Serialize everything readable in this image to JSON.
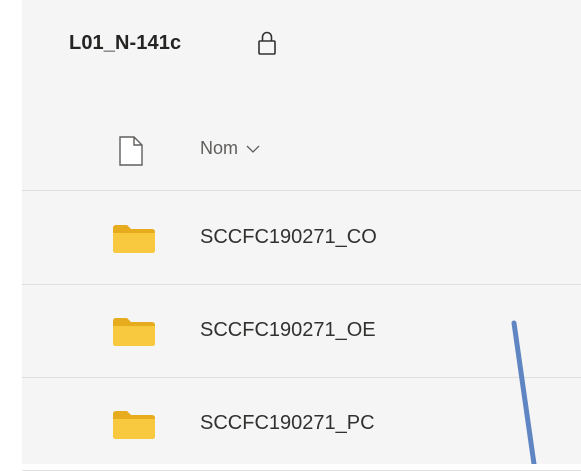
{
  "library": {
    "title": "L01_N-141c",
    "lock_icon": "lock-icon"
  },
  "columns": {
    "file_type_icon": "document-icon",
    "name_label": "Nom",
    "sort_icon": "chevron-down-icon"
  },
  "items": [
    {
      "name": "SCCFC190271_CO",
      "icon": "folder-icon"
    },
    {
      "name": "SCCFC190271_OE",
      "icon": "folder-icon"
    },
    {
      "name": "SCCFC190271_PC",
      "icon": "folder-icon"
    }
  ],
  "colors": {
    "folder": "#f8c93f",
    "folder_tab": "#e6ac1e",
    "annotation_line": "#5f86c2",
    "background": "#f5f5f5"
  }
}
